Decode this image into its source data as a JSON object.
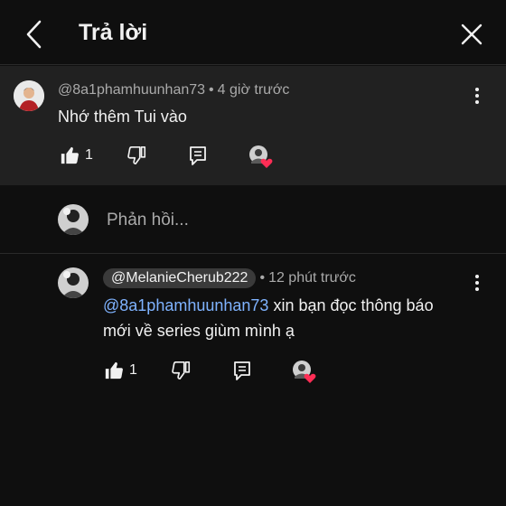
{
  "header": {
    "title": "Trả lời"
  },
  "parent_comment": {
    "author": "@8a1phamhuunhan73",
    "time": "4 giờ trước",
    "text": "Nhớ thêm Tui vào",
    "likes": "1"
  },
  "reply_box": {
    "placeholder": "Phản hồi..."
  },
  "reply_comment": {
    "author": "@MelanieCherub222",
    "time": "12 phút trước",
    "mention": "@8a1phamhuunhan73",
    "text_line1": " xin bạn đọc thông báo",
    "text_line2": "mới về series giùm mình ạ",
    "likes": "1"
  },
  "colors": {
    "background": "#0f0f0f",
    "highlight_background": "#212121",
    "mention_link": "#7fb3ff",
    "heart": "#ff2d55"
  },
  "icons": [
    "back-arrow-icon",
    "close-icon",
    "thumbs-up-icon",
    "thumbs-down-icon",
    "reply-comment-icon",
    "more-vertical-icon",
    "heart-icon"
  ]
}
